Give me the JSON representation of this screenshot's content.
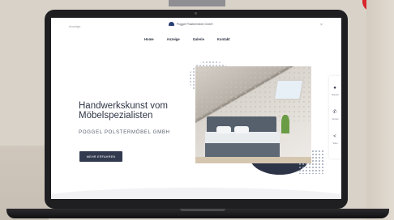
{
  "website": {
    "top_left_text": "Anzeige",
    "logo_text": "Poggel Polstermöbel GmbH",
    "close_icon": "×",
    "nav": [
      {
        "label": "Home"
      },
      {
        "label": "Anzeige"
      },
      {
        "label": "Galerie"
      },
      {
        "label": "Kontakt"
      }
    ],
    "hero": {
      "headline_line1": "Handwerkskunst vom",
      "headline_line2": "Möbelspezialisten",
      "subheadline": "POGGEL POLSTERMÖBEL GMBH",
      "cta_label": "MEHR ERFAHREN"
    },
    "side_actions": [
      {
        "icon": "●",
        "icon_name": "location-icon",
        "label": "Standort"
      },
      {
        "icon": "✆",
        "icon_name": "phone-icon",
        "label": "Anrufen"
      },
      {
        "icon": "<",
        "icon_name": "share-icon",
        "label": "Teilen"
      }
    ]
  }
}
